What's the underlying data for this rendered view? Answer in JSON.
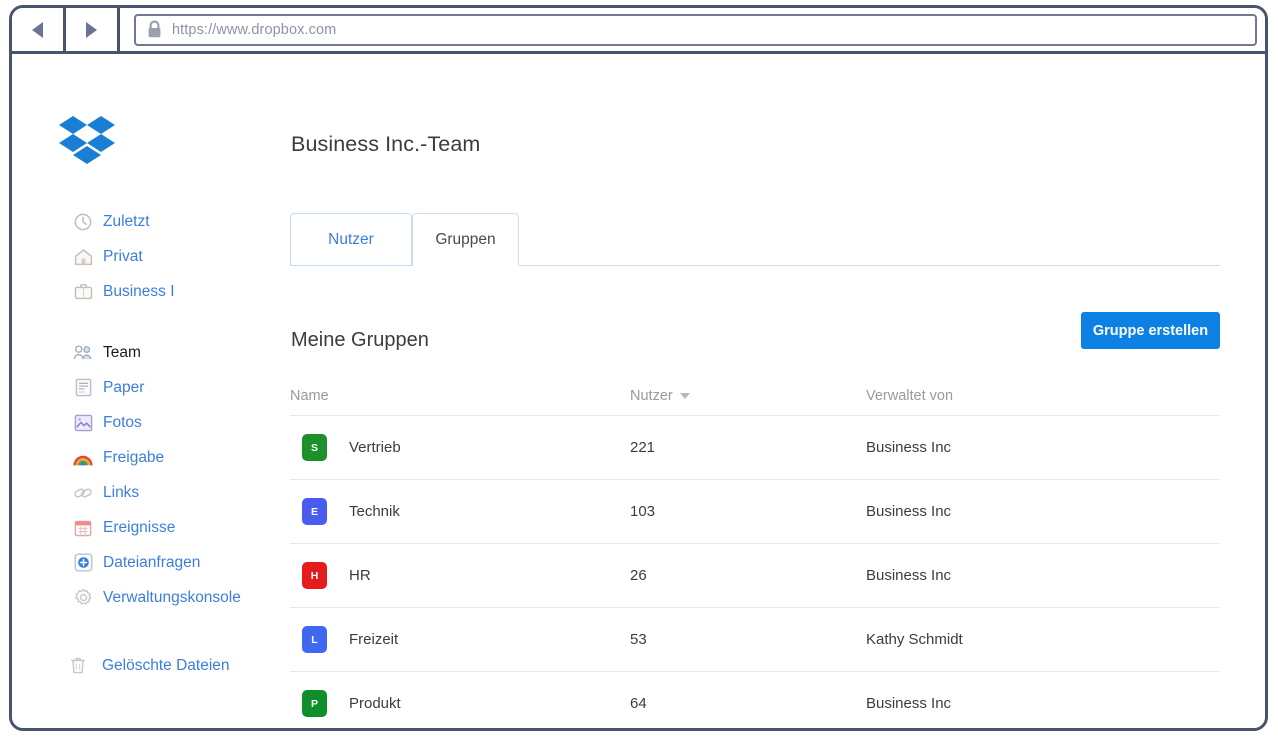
{
  "browser": {
    "back_label": "Back",
    "forward_label": "Forward",
    "lock_icon": "lock-icon",
    "url": "https://www.dropbox.com"
  },
  "brand": {
    "logo_name": "dropbox-logo",
    "logo_color": "#1a7fd4"
  },
  "sidebar": {
    "groups": [
      {
        "items": [
          {
            "label": "Zuletzt",
            "icon": "clock-icon",
            "active": false
          },
          {
            "label": "Privat",
            "icon": "home-icon",
            "active": false
          },
          {
            "label": "Business I",
            "icon": "briefcase-icon",
            "active": false
          }
        ]
      },
      {
        "items": [
          {
            "label": "Team",
            "icon": "people-icon",
            "active": true
          },
          {
            "label": "Paper",
            "icon": "document-icon",
            "active": false
          },
          {
            "label": "Fotos",
            "icon": "photo-icon",
            "active": false
          },
          {
            "label": "Freigabe",
            "icon": "rainbow-icon",
            "active": false
          },
          {
            "label": "Links",
            "icon": "link-icon",
            "active": false
          },
          {
            "label": "Ereignisse",
            "icon": "calendar-icon",
            "active": false
          },
          {
            "label": "Dateianfragen",
            "icon": "plus-circle-icon",
            "active": false
          },
          {
            "label": "Verwaltungskonsole",
            "icon": "gear-icon",
            "active": false
          }
        ]
      },
      {
        "items": [
          {
            "label": "Gelöschte Dateien",
            "icon": "trash-icon",
            "active": false
          }
        ]
      }
    ]
  },
  "main": {
    "page_title": "Business Inc.-Team",
    "tabs": [
      {
        "label": "Nutzer",
        "active": false
      },
      {
        "label": "Gruppen",
        "active": true
      }
    ],
    "section_title": "Meine Gruppen",
    "create_button": "Gruppe erstellen",
    "table": {
      "columns": [
        "Name",
        "Nutzer",
        "Verwaltet von"
      ],
      "sorted_column": "Nutzer",
      "sort_direction": "desc",
      "rows": [
        {
          "badge": "S",
          "badge_color": "#1d8f2b",
          "name": "Vertrieb",
          "users": "221",
          "managed_by": "Business Inc"
        },
        {
          "badge": "E",
          "badge_color": "#4a5bf0",
          "name": "Technik",
          "users": "103",
          "managed_by": "Business Inc"
        },
        {
          "badge": "H",
          "badge_color": "#e51c1c",
          "name": "HR",
          "users": "26",
          "managed_by": "Business Inc"
        },
        {
          "badge": "L",
          "badge_color": "#3f68f0",
          "name": "Freizeit",
          "users": "53",
          "managed_by": "Kathy Schmidt"
        },
        {
          "badge": "P",
          "badge_color": "#0f8f2b",
          "name": "Produkt",
          "users": "64",
          "managed_by": "Business Inc"
        }
      ]
    }
  },
  "colors": {
    "link_blue": "#3b7ede",
    "accent_blue": "#0c80e3",
    "frame": "#49536e"
  }
}
